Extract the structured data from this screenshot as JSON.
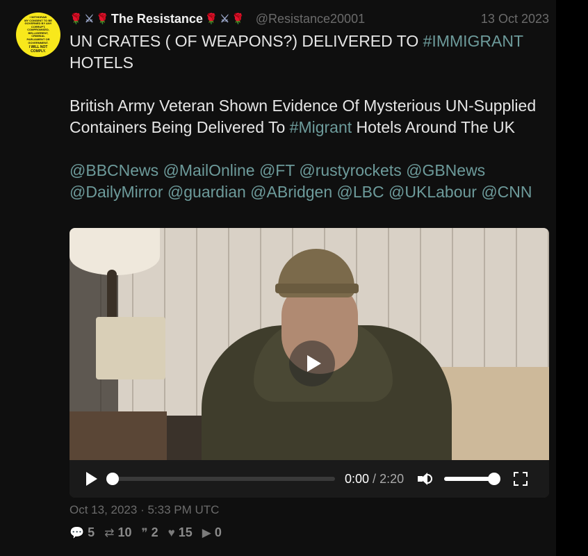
{
  "avatar": {
    "lines": [
      "I WITHDRAW",
      "MY CONSENT TO BE",
      "GOVERNED BY ANY",
      "CORRUPT, COMPROMISED,",
      "BELLIGERENT, CRIMINAL",
      "PARLIAMENT OR",
      "GOVERNMENT."
    ],
    "strong": "I WILL NOT COMPLY."
  },
  "author": {
    "display_name": "The Resistance",
    "username": "@Resistance20001",
    "emoji_left": [
      "🌹",
      "⚔",
      "🌹"
    ],
    "emoji_right": [
      "🌹",
      "⚔",
      "🌹"
    ]
  },
  "tweet": {
    "date": "13 Oct 2023",
    "line1_pre": "UN CRATES ( OF WEAPONS?) DELIVERED TO ",
    "line1_tag": "#IMMIGRANT",
    "line1_post": "HOTELS",
    "para2_pre": "British Army Veteran Shown Evidence Of Mysterious UN-Supplied Containers Being Delivered To ",
    "para2_tag": "#Migrant",
    "para2_post": " Hotels Around The UK",
    "mentions": [
      "@BBCNews",
      "@MailOnline",
      "@FT",
      "@rustyrockets",
      "@GBNews",
      "@DailyMirror",
      "@guardian",
      "@ABridgen",
      "@LBC",
      "@UKLabour",
      "@CNN"
    ]
  },
  "video": {
    "current_time": "0:00",
    "separator": "/",
    "duration": "2:20",
    "progress_fraction": 0.0,
    "volume_fraction": 1.0
  },
  "published": "Oct 13, 2023 · 5:33 PM UTC",
  "stats": {
    "replies": "5",
    "retweets": "10",
    "quotes": "2",
    "likes": "15",
    "plays": "0"
  },
  "icons": {
    "reply": "comment-icon",
    "retweet": "retweet-icon",
    "quote": "quote-icon",
    "like": "heart-icon",
    "play": "play-icon"
  },
  "colors": {
    "background": "#0f0f0f",
    "link": "#6d9b9b",
    "muted": "#6b6b6b",
    "avatar": "#f8e81c"
  }
}
